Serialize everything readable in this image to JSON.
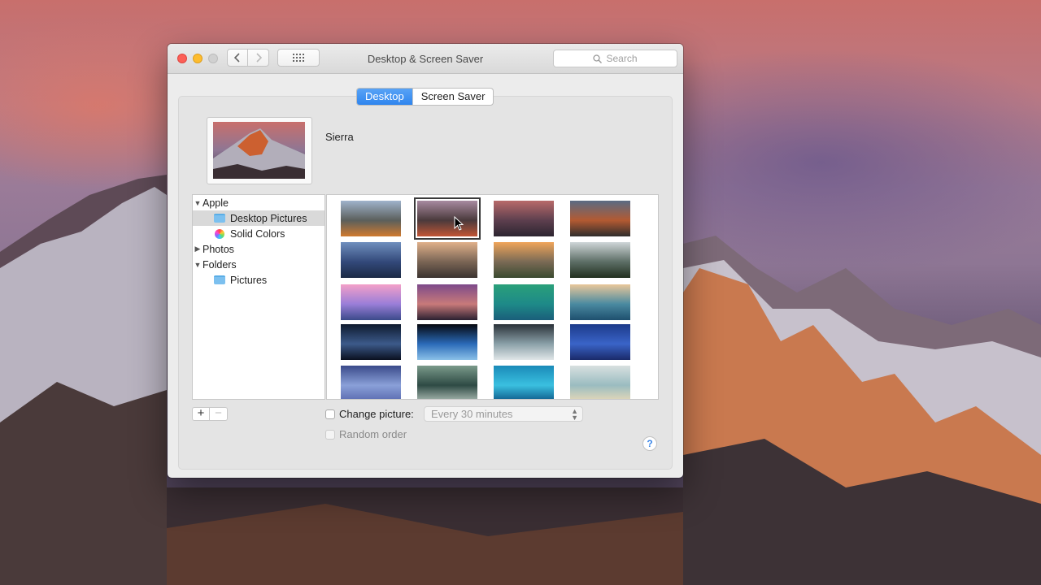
{
  "window": {
    "title": "Desktop & Screen Saver",
    "search_placeholder": "Search"
  },
  "tabs": [
    {
      "label": "Desktop",
      "active": true
    },
    {
      "label": "Screen Saver",
      "active": false
    }
  ],
  "preview": {
    "name": "Sierra"
  },
  "sidebar": {
    "apple": "Apple",
    "desktop_pictures": "Desktop Pictures",
    "solid_colors": "Solid Colors",
    "photos": "Photos",
    "folders": "Folders",
    "pictures": "Pictures"
  },
  "thumbnails": [
    {
      "colors": [
        "#9fb3cc",
        "#5b5f5c",
        "#d07a2f"
      ],
      "selected": false
    },
    {
      "colors": [
        "#a88aa0",
        "#4a3a3c",
        "#c25535"
      ],
      "selected": true
    },
    {
      "colors": [
        "#b86a6a",
        "#5d3f4e",
        "#2c2530"
      ],
      "selected": false
    },
    {
      "colors": [
        "#5a6b83",
        "#b35a32",
        "#2f2d2c"
      ],
      "selected": false
    },
    {
      "colors": [
        "#6f8fbe",
        "#33497a",
        "#1b2a45"
      ],
      "selected": false
    },
    {
      "colors": [
        "#e0b08a",
        "#7a6555",
        "#3b3330"
      ],
      "selected": false
    },
    {
      "colors": [
        "#f0a55a",
        "#7a6a55",
        "#3a4a30"
      ],
      "selected": false
    },
    {
      "colors": [
        "#cfd6d8",
        "#5d6e66",
        "#22301f"
      ],
      "selected": false
    },
    {
      "colors": [
        "#f3a0c8",
        "#9a7ed8",
        "#3b4a8a"
      ],
      "selected": false
    },
    {
      "colors": [
        "#7d4a8a",
        "#c87a7a",
        "#2a2030"
      ],
      "selected": false
    },
    {
      "colors": [
        "#2aa07a",
        "#1e8a88",
        "#1a5e7a"
      ],
      "selected": false
    },
    {
      "colors": [
        "#e9c79a",
        "#4a8aa0",
        "#1e4f6e"
      ],
      "selected": false
    },
    {
      "colors": [
        "#0e1a2e",
        "#3c5a8a",
        "#0a1020"
      ],
      "selected": false
    },
    {
      "colors": [
        "#05080f",
        "#2a6ab8",
        "#8ac0e8"
      ],
      "selected": false
    },
    {
      "colors": [
        "#2a3138",
        "#8aa0a8",
        "#e0e6e8"
      ],
      "selected": false
    },
    {
      "colors": [
        "#1c3a8a",
        "#3a64c8",
        "#1a2a6a"
      ],
      "selected": false
    },
    {
      "colors": [
        "#3a4a8a",
        "#8aa0d8",
        "#5a6ab0"
      ],
      "selected": false
    },
    {
      "colors": [
        "#7a9a8a",
        "#2e4a44",
        "#a8b8b0"
      ],
      "selected": false
    },
    {
      "colors": [
        "#1a8ab8",
        "#3ac0e0",
        "#0e5a8a"
      ],
      "selected": false
    },
    {
      "colors": [
        "#d8e0e0",
        "#9abcc0",
        "#e6d8b8"
      ],
      "selected": false
    }
  ],
  "bottom": {
    "plus": "+",
    "minus": "−",
    "change_picture": "Change picture:",
    "interval": "Every 30 minutes",
    "random_order": "Random order",
    "help": "?"
  }
}
